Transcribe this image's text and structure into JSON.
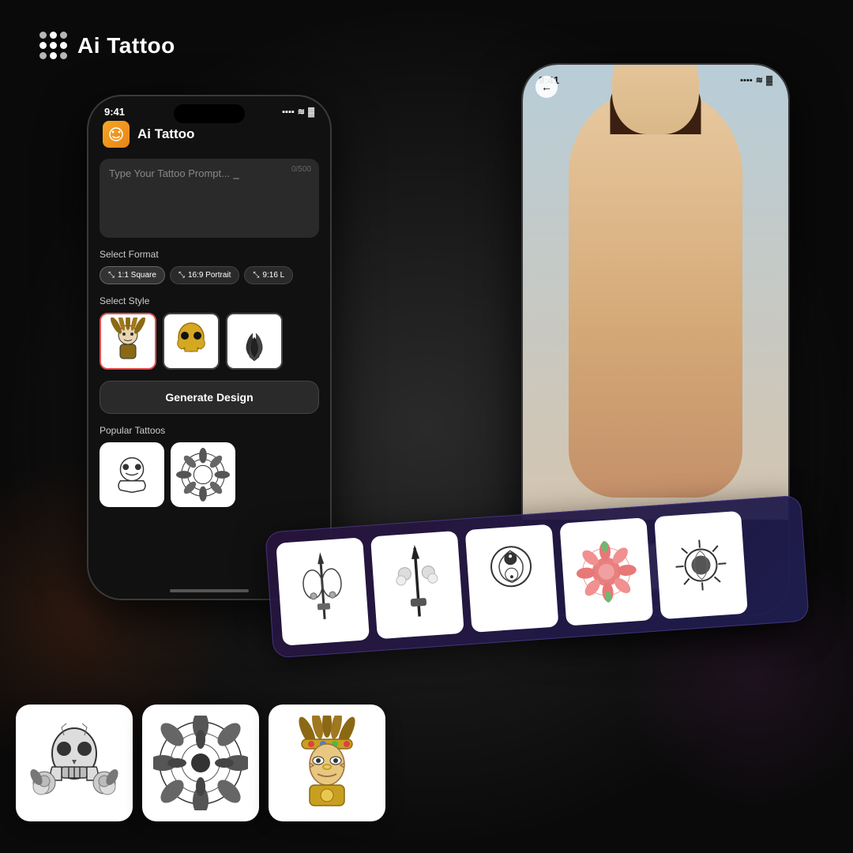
{
  "app": {
    "name": "Ai Tattoo",
    "logo_alt": "AI Tattoo Logo"
  },
  "header": {
    "title": "Ai Tattoo",
    "time": "9:41",
    "signal": "●●●●",
    "wifi": "▲",
    "battery": "▓"
  },
  "left_phone": {
    "status_time": "9:41",
    "app_title": "Ai Tattoo",
    "prompt_placeholder": "Type Your Tattoo Prompt...",
    "prompt_counter": "0/500",
    "select_format_label": "Select Format",
    "formats": [
      {
        "label": "1:1 Square",
        "active": true
      },
      {
        "label": "16:9 Portrait",
        "active": false
      },
      {
        "label": "9:16 L",
        "active": false
      }
    ],
    "select_style_label": "Select Style",
    "generate_btn_label": "Generate Design",
    "popular_label": "Popular Tattoos"
  },
  "right_phone": {
    "status_time": "9:41",
    "back_icon": "←"
  },
  "carousel": {
    "cards": [
      {
        "id": 1,
        "alt": "floral dagger tattoo"
      },
      {
        "id": 2,
        "alt": "ornate dagger with flowers"
      },
      {
        "id": 3,
        "alt": "fish and moon tattoo"
      },
      {
        "id": 4,
        "alt": "mandala flower tattoo"
      },
      {
        "id": 5,
        "alt": "sun and moon tattoo"
      }
    ]
  },
  "popular_tattoos": [
    {
      "id": 1,
      "alt": "skull with flowers tattoo"
    },
    {
      "id": 2,
      "alt": "mandala flower tattoo"
    },
    {
      "id": 3,
      "alt": "aztec warrior tattoo"
    }
  ],
  "style_cards": [
    {
      "id": 1,
      "selected": true,
      "alt": "aztec warrior style"
    },
    {
      "id": 2,
      "selected": false,
      "alt": "golden skull style"
    },
    {
      "id": 3,
      "selected": false,
      "alt": "dark flame style"
    }
  ],
  "colors": {
    "bg": "#111111",
    "accent_orange": "#f5a623",
    "selected_border": "#e05050",
    "phone_body": "#1a1a1a"
  }
}
